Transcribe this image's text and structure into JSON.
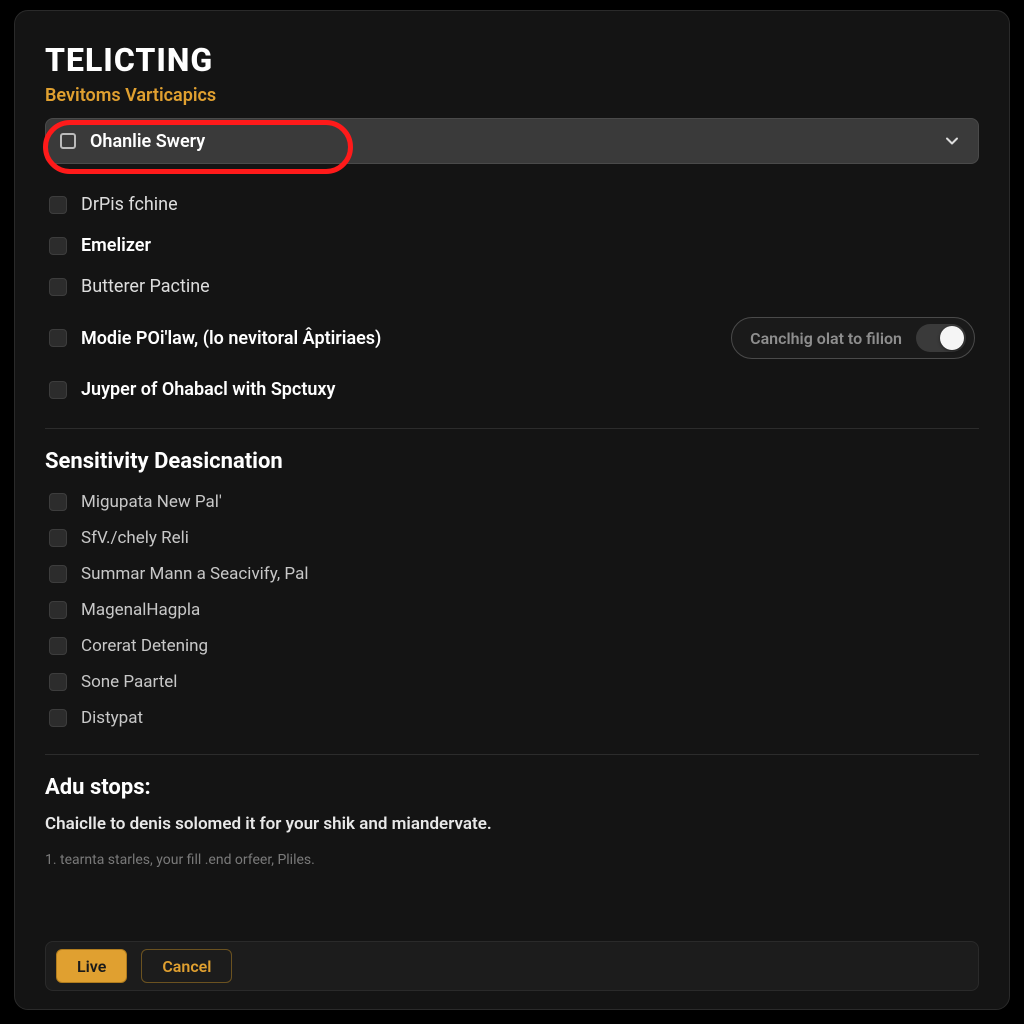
{
  "colors": {
    "accent": "#e0a030",
    "highlight_ring": "#ff1a1a",
    "bg_window": "#141414",
    "bg_dropdown": "#3a3a3a"
  },
  "header": {
    "title": "TELICTING",
    "subtitle": "Bevitoms Varticapics"
  },
  "dropdown": {
    "selected_label": "Ohanlie Swery"
  },
  "group1": {
    "items": [
      {
        "label": "DrPis fchine",
        "bold": false
      },
      {
        "label": "Emelizer",
        "bold": true
      },
      {
        "label": "Butterer Pactine",
        "bold": false
      },
      {
        "label": "Modie POi'law, (lo nevitoral Âptiriaes)",
        "bold": true,
        "has_toggle": true
      },
      {
        "label": "Juyper of Ohabacl with Spctuxy",
        "bold": true
      }
    ],
    "toggle_hint": "Canclhig olat to filion",
    "toggle_on": true
  },
  "section_sensitivity": {
    "title": "Sensitivity Deasicnation",
    "items": [
      {
        "label": "Migupata New Pal'"
      },
      {
        "label": "SfV./chely Reli"
      },
      {
        "label": "Summar Mann a Seacivify, Pal"
      },
      {
        "label": "MagenalHagpla"
      },
      {
        "label": "Corerat Detening"
      },
      {
        "label": "Sone Paartel"
      },
      {
        "label": "Distypat"
      }
    ]
  },
  "section_adu": {
    "title": "Adu stops:",
    "desc": "Chaiclle to denis solomed it for your shik and miandervate.",
    "note": "1. tearnta starles, your fill .end orfeer, Pliles."
  },
  "buttons": {
    "live": "Live",
    "cancel": "Cancel"
  }
}
